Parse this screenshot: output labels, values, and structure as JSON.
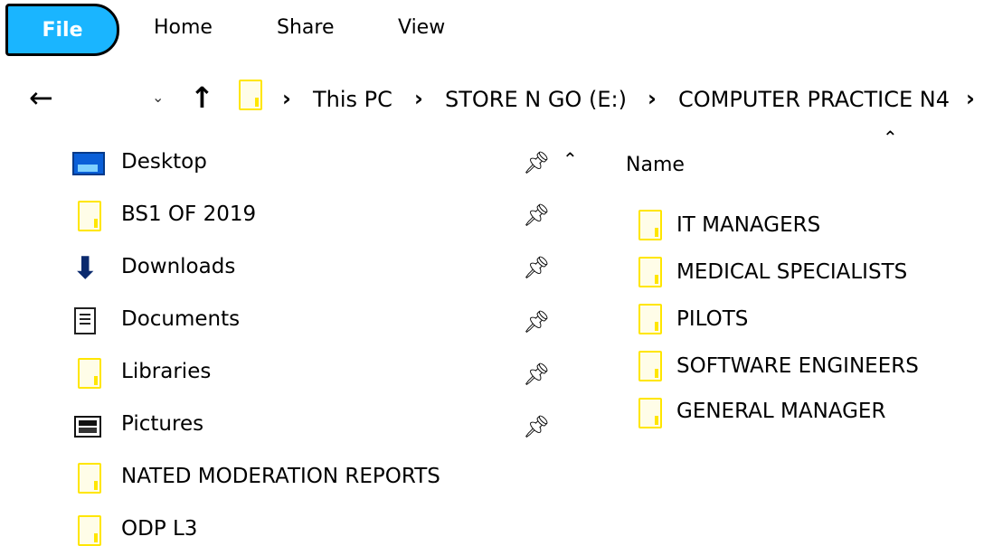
{
  "ribbon": {
    "file_label": "File",
    "home_label": "Home",
    "share_label": "Share",
    "view_label": "View"
  },
  "address_bar": {
    "crumbs": [
      "This PC",
      "STORE N GO (E:)",
      "COMPUTER PRACTICE N4"
    ],
    "separator": "›"
  },
  "nav_pane": {
    "items": [
      {
        "label": "Desktop",
        "icon": "desktop-icon",
        "pinned": true
      },
      {
        "label": "BS1 OF 2019",
        "icon": "folder-icon",
        "pinned": true
      },
      {
        "label": "Downloads",
        "icon": "download-icon",
        "pinned": true
      },
      {
        "label": "Documents",
        "icon": "documents-icon",
        "pinned": true
      },
      {
        "label": "Libraries",
        "icon": "folder-icon",
        "pinned": true
      },
      {
        "label": "Pictures",
        "icon": "pictures-icon",
        "pinned": true
      },
      {
        "label": "NATED MODERATION REPORTS",
        "icon": "folder-icon",
        "pinned": false
      },
      {
        "label": "ODP L3",
        "icon": "folder-icon",
        "pinned": false
      }
    ]
  },
  "content": {
    "column_header": "Name",
    "items": [
      {
        "label": "IT MANAGERS"
      },
      {
        "label": "MEDICAL SPECIALISTS"
      },
      {
        "label": "PILOTS"
      },
      {
        "label": "SOFTWARE ENGINEERS"
      },
      {
        "label": "GENERAL MANAGER"
      }
    ]
  },
  "colors": {
    "file_tab": "#1ab5ff",
    "folder": "#ffe600"
  }
}
